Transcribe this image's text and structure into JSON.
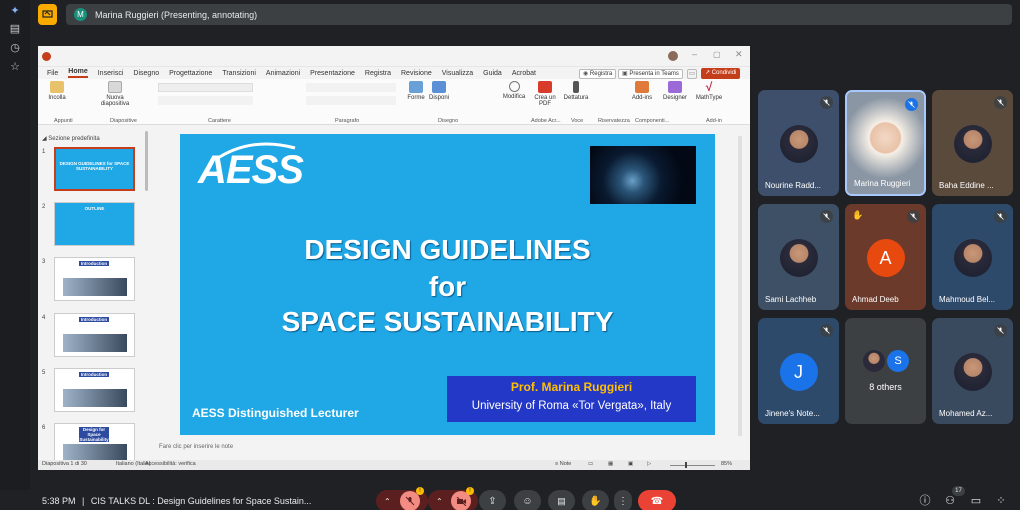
{
  "presenter_banner": {
    "initial": "M",
    "text": "Marina Ruggieri (Presenting, annotating)"
  },
  "ppt": {
    "menu": [
      "File",
      "Home",
      "Inserisci",
      "Disegno",
      "Progettazione",
      "Transizioni",
      "Animazioni",
      "Presentazione",
      "Registra",
      "Revisione",
      "Visualizza",
      "Guida",
      "Acrobat"
    ],
    "registra": "Registra",
    "presenta_teams": "Presenta in Teams",
    "condividi": "Condividi",
    "ribbon_buttons": {
      "incolla": "Incolla",
      "nuova": "Nuova diapositiva",
      "forme": "Forme",
      "disponi": "Disponi",
      "modifica": "Modifica",
      "crea_pdf": "Crea un PDF",
      "dettatura": "Dettatura",
      "addins": "Add-ins",
      "designer": "Designer",
      "mathtype": "MathType"
    },
    "groups": {
      "appunti": "Appunti",
      "diapositive": "Diapositive",
      "carattere": "Carattere",
      "paragrafo": "Paragrafo",
      "disegno": "Disegno",
      "adobe": "Adobe Acr...",
      "voce": "Voce",
      "riservatezza": "Riservatezza",
      "componenti": "Componenti...",
      "addin": "Add-in"
    },
    "sezione": "Sezione predefinita",
    "thumbnails": [
      {
        "num": "1",
        "title": "DESIGN GUIDELINES for SPACE SUSTAINABILITY"
      },
      {
        "num": "2",
        "title": "OUTLINE"
      },
      {
        "num": "3",
        "title": "Introduction"
      },
      {
        "num": "4",
        "title": "Introduction"
      },
      {
        "num": "5",
        "title": "Introduction"
      },
      {
        "num": "6",
        "title": "Design for Space Sustainability"
      }
    ],
    "slide": {
      "logo": "AESS",
      "title_1": "DESIGN GUIDELINES",
      "title_2": "for",
      "title_3": "SPACE SUSTAINABILITY",
      "presenter": "Prof. Marina Ruggieri",
      "university": "University of Roma «Tor Vergata», Italy",
      "lecturer": "AESS Distinguished Lecturer"
    },
    "notes": "Fare clic per inserire le note",
    "status": {
      "slide": "Diapositiva 1 di 30",
      "lang": "Italiano (Italia)",
      "access": "Accessibilità: verifica",
      "note": "Note",
      "zoom": "85%"
    }
  },
  "participants": [
    {
      "name": "Nourine Radd...",
      "type": "photo",
      "bg": "#3d4f6b"
    },
    {
      "name": "Marina Ruggieri",
      "type": "video",
      "bg": "#7a8896"
    },
    {
      "name": "Baha Eddine ...",
      "type": "photo",
      "bg": "#5a4a3c"
    },
    {
      "name": "Sami Lachheb",
      "type": "photo",
      "bg": "#3e5066"
    },
    {
      "name": "Ahmad Deeb",
      "type": "letter",
      "letter": "A",
      "bg": "#6b3a2a",
      "circle": "#e8490f"
    },
    {
      "name": "Mahmoud Bel...",
      "type": "photo",
      "bg": "#2d4a6b"
    },
    {
      "name": "Jinene's Note...",
      "type": "letter",
      "letter": "J",
      "bg": "#2d4a6b",
      "circle": "#1a73e8"
    },
    {
      "name": "8 others",
      "type": "others",
      "letter": "S",
      "bg": "#3c4043"
    },
    {
      "name": "Mohamed Az...",
      "type": "photo",
      "bg": "#3a4a5e"
    }
  ],
  "bottom": {
    "time": "5:38 PM",
    "separator": "|",
    "meeting": "CIS TALKS DL : Design Guidelines for Space Sustain...",
    "people_count": "17"
  }
}
